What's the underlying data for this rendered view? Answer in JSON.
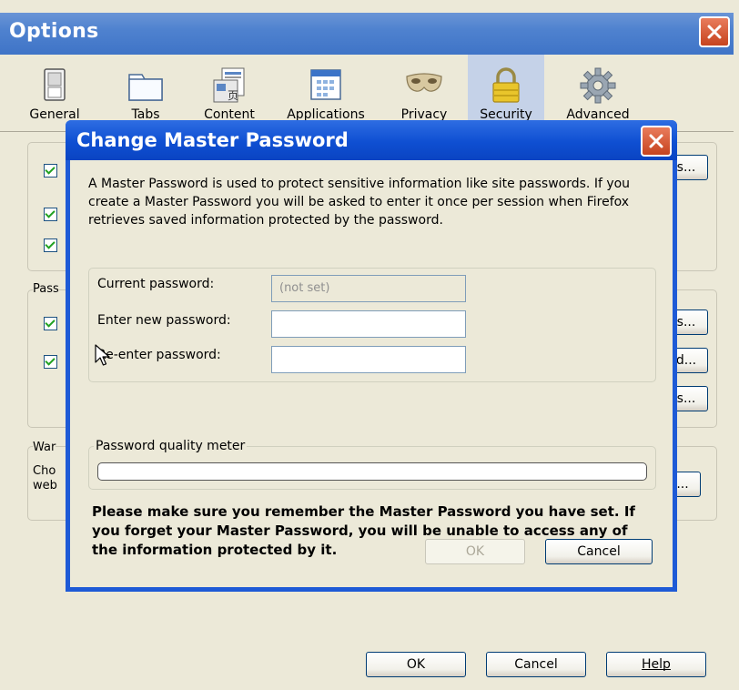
{
  "options": {
    "title": "Options",
    "tabs": [
      {
        "label": "General",
        "icon": "general-switch-icon"
      },
      {
        "label": "Tabs",
        "icon": "tabs-icon"
      },
      {
        "label": "Content",
        "icon": "content-icon"
      },
      {
        "label": "Applications",
        "icon": "applications-icon"
      },
      {
        "label": "Privacy",
        "icon": "privacy-mask-icon"
      },
      {
        "label": "Security",
        "icon": "security-padlock-icon"
      },
      {
        "label": "Advanced",
        "icon": "advanced-gear-icon"
      }
    ],
    "active_tab": "Security",
    "background": {
      "passwords_group_label_partial": "Pass",
      "warnings_group_label_partial": "War",
      "warnings_text_line1_partial": "Cho",
      "warnings_text_line2_partial": "web",
      "button_fragments": [
        "s...",
        "s...",
        "d...",
        "s...",
        "..."
      ]
    },
    "footer": {
      "ok_label": "OK",
      "cancel_label": "Cancel",
      "help_label": "Help"
    }
  },
  "dialog": {
    "title": "Change Master Password",
    "description": "A Master Password is used to protect sensitive information like site passwords. If you create a Master Password you will be asked to enter it once per session when Firefox retrieves saved information protected by the password.",
    "current_label": "Current password:",
    "current_value": "(not set)",
    "new_label": "Enter new password:",
    "new_value": "",
    "reenter_label": "Re-enter password:",
    "reenter_value": "",
    "quality_label": "Password quality meter",
    "quality_level": 0,
    "warning": "Please make sure you remember the Master Password you have set. If you forget your Master Password, you will be unable to access any of the information protected by it.",
    "ok_label": "OK",
    "cancel_label": "Cancel"
  },
  "colors": {
    "titlebar_options": "#4f82cf",
    "titlebar_dialog": "#0f4fd2",
    "close_button": "#d65a34",
    "window_bg": "#ece9d8"
  }
}
